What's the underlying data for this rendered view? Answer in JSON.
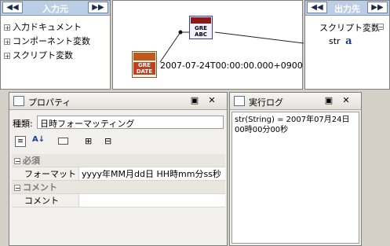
{
  "input_pane": {
    "title": "入力元",
    "prev": "◀◀",
    "next": "▶▶",
    "items": [
      "入力ドキュメント",
      "コンポーネント変数",
      "スクリプト変数"
    ]
  },
  "canvas": {
    "date_value": "2007-07-24T00:00:00.000+0900",
    "format_icon_text": "GRE\nABC",
    "date_icon_text": "GRE\nDATE"
  },
  "output_pane": {
    "title": "出力先",
    "prev": "◀◀",
    "next": "▶▶",
    "group": "スクリプト変数",
    "var_name": "str",
    "var_icon": "a"
  },
  "properties": {
    "title": "プロパティ",
    "type_label": "種類:",
    "type_value": "日時フォーマッティング",
    "sections": [
      {
        "name": "必須",
        "rows": [
          {
            "key": "フォーマット",
            "value": "yyyy年MM月dd日  HH時mm分ss秒"
          }
        ]
      },
      {
        "name": "コメント",
        "rows": [
          {
            "key": "コメント",
            "value": ""
          }
        ]
      }
    ]
  },
  "log": {
    "title": "実行ログ",
    "content": "str(String) = 2007年07月24日 00時00分00秒"
  }
}
